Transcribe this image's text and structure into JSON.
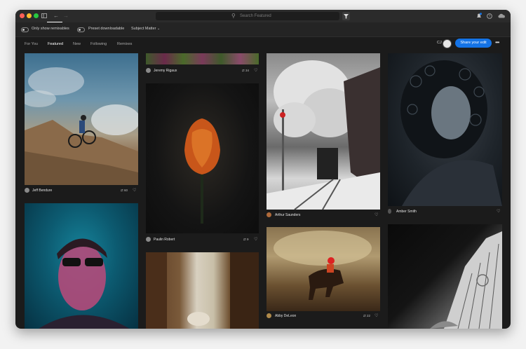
{
  "search": {
    "placeholder": "Search Featured"
  },
  "toolbar": {
    "remixables_label": "Only show remixables",
    "downloadable_label": "Preset downloadable",
    "subject_label": "Subject Matter"
  },
  "tabs": [
    {
      "label": "For You"
    },
    {
      "label": "Featured"
    },
    {
      "label": "New"
    },
    {
      "label": "Following"
    },
    {
      "label": "Remixes"
    }
  ],
  "header": {
    "initials": "CJ",
    "share_label": "Share your edit",
    "more_label": "•••"
  },
  "cards": [
    {
      "author": "Jeff Bendure",
      "remixes": "60"
    },
    {
      "author": "Jeremy Rigaux",
      "remixes": "34"
    },
    {
      "author": "Paulin Robert",
      "remixes": "9"
    },
    {
      "author": "Arthur Saunders",
      "remixes": ""
    },
    {
      "author": "Abby DeLeon",
      "remixes": "22"
    },
    {
      "author": "Amber Smith",
      "remixes": ""
    }
  ],
  "colors": {
    "accent": "#1473e6",
    "background": "#1b1b1b",
    "toolbar": "#242424"
  }
}
